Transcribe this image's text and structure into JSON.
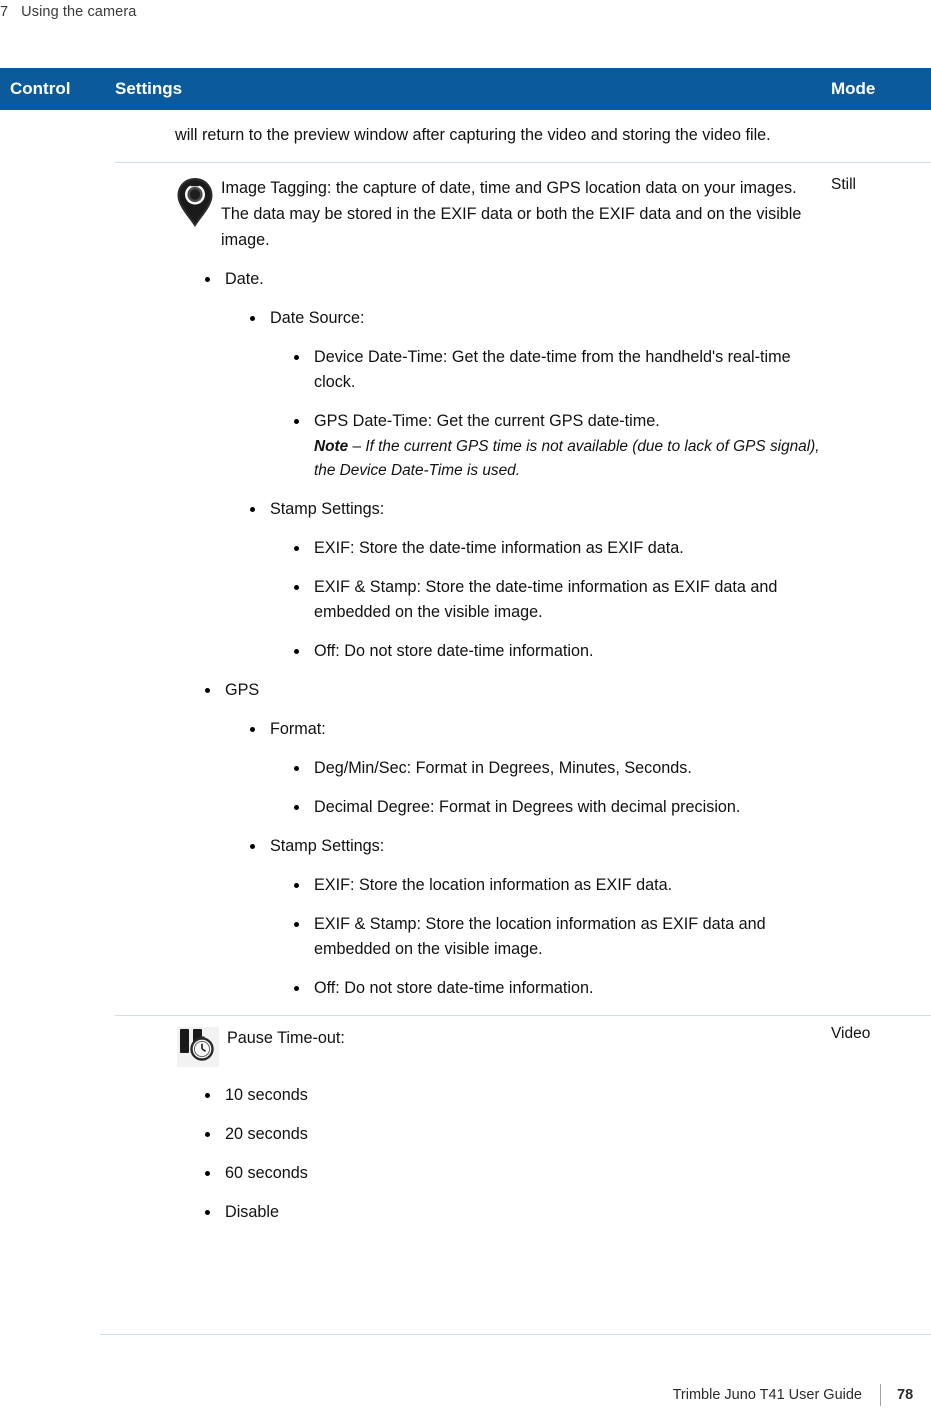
{
  "running_header": {
    "chapter_number": "7",
    "chapter_title": "Using the camera"
  },
  "table": {
    "headers": {
      "control": "Control",
      "settings": "Settings",
      "mode": "Mode"
    },
    "rows": [
      {
        "mode": "",
        "continued_text": "will return to the preview window after capturing the video and storing the video file."
      },
      {
        "mode": "Still",
        "icon": "location-pin-camera-icon",
        "lead": "Image Tagging: the capture of date, time and GPS location data on your images. The data may be stored in the EXIF data or both the EXIF data and on the visible image.",
        "bullets": [
          {
            "label": "Date.",
            "children": [
              {
                "label": "Date Source:",
                "children": [
                  {
                    "label": "Device Date-Time: Get the date-time from the handheld's real-time clock."
                  },
                  {
                    "label": "GPS Date-Time: Get the current GPS date-time.",
                    "note": {
                      "label": "Note",
                      "dash": " – ",
                      "text": "If the current GPS time is not available (due to lack of GPS signal), the Device Date-Time is used."
                    }
                  }
                ]
              },
              {
                "label": "Stamp Settings:",
                "children": [
                  {
                    "label": "EXIF: Store the date-time information as EXIF data."
                  },
                  {
                    "label": "EXIF & Stamp: Store the date-time information as EXIF data and embedded on the visible image."
                  },
                  {
                    "label": "Off: Do not store date-time information."
                  }
                ]
              }
            ]
          },
          {
            "label": "GPS",
            "children": [
              {
                "label": "Format:",
                "children": [
                  {
                    "label": "Deg/Min/Sec: Format in Degrees, Minutes, Seconds."
                  },
                  {
                    "label": "Decimal Degree: Format in Degrees with decimal precision."
                  }
                ]
              },
              {
                "label": "Stamp Settings:",
                "children": [
                  {
                    "label": "EXIF: Store the location information as EXIF data."
                  },
                  {
                    "label": "EXIF & Stamp: Store the location information as EXIF data and embedded on the visible image."
                  },
                  {
                    "label": "Off: Do not store date-time information."
                  }
                ]
              }
            ]
          }
        ]
      },
      {
        "mode": "Video",
        "icon": "pause-timeout-icon",
        "lead": "Pause Time-out:",
        "options": [
          "10 seconds",
          "20 seconds",
          "60 seconds",
          "Disable"
        ]
      }
    ]
  },
  "footer": {
    "title": "Trimble Juno T41 User Guide",
    "page": "78"
  },
  "colors": {
    "header_bar": "#0a5a9c",
    "rule": "#cfe0ea",
    "text": "#111111"
  }
}
